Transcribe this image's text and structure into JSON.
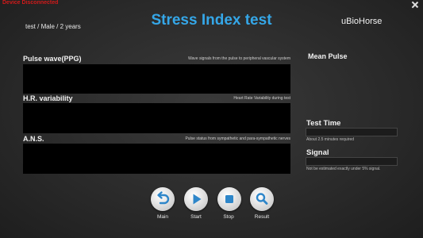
{
  "header": {
    "status": "Device Disconnected",
    "subject": "test / Male / 2 years",
    "title": "Stress Index test",
    "brand": "uBioHorse"
  },
  "sections": {
    "pulse_wave": {
      "label": "Pulse wave(PPG)",
      "description": "Wave signals from the pulse to peripheral vascular system"
    },
    "hr_variability": {
      "label": "H.R. variability",
      "description": "Heart Rate Variability during test"
    },
    "ans": {
      "label": "A.N.S.",
      "description": "Pulse status from sympathetic and para-sympathetic nerves"
    }
  },
  "side": {
    "mean_pulse": "Mean Pulse",
    "test_time": {
      "label": "Test Time",
      "note": "About 2.5 minutes required"
    },
    "signal": {
      "label": "Signal",
      "note": "Not be estimated exactly under 5% signal."
    }
  },
  "controls": {
    "main": "Main",
    "start": "Start",
    "stop": "Stop",
    "result": "Result"
  },
  "colors": {
    "title": "#35a7e8",
    "status": "#d11a1a",
    "accent_icon": "#2e86c9"
  }
}
